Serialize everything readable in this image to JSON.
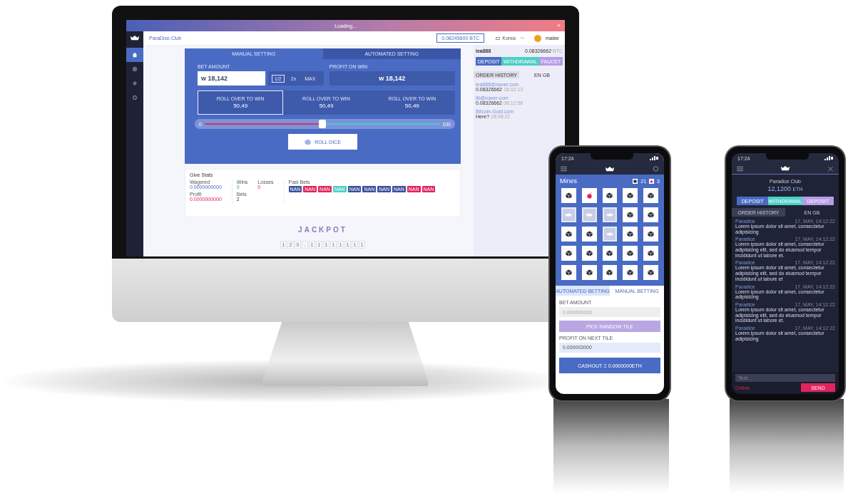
{
  "desktop": {
    "title_bar": {
      "title": "Loading...",
      "close": "×"
    },
    "sidebar": {
      "items": [
        {
          "kind": "home",
          "selected": true
        },
        {
          "kind": "dice",
          "selected": false
        },
        {
          "kind": "club",
          "selected": false
        },
        {
          "kind": "coin",
          "selected": false
        }
      ]
    },
    "header": {
      "brand": "ParaDice.Club",
      "balance": "0.08245600 BTC",
      "language": "Korea",
      "user": "malee"
    },
    "game": {
      "tabs": [
        {
          "label": "MANUAL SETTING",
          "selected": true
        },
        {
          "label": "AUTOMATED SETTING",
          "selected": false
        }
      ],
      "bet_label": "BET AMOUNT",
      "bet_value": "w 18,142",
      "multipliers": [
        {
          "label": "1/2",
          "selected": true
        },
        {
          "label": "2x",
          "selected": false
        },
        {
          "label": "MAX",
          "selected": false
        }
      ],
      "profit_label": "PROFIT ON WIN",
      "profit_value": "w 18,142",
      "rolls": [
        {
          "label": "ROLL OVER TO WIN",
          "value": "50,49",
          "selected": true
        },
        {
          "label": "ROLL OVER TO WIN",
          "value": "50,49",
          "selected": false
        },
        {
          "label": "ROLL OVER TO WIN",
          "value": "50,49",
          "selected": false
        }
      ],
      "slider": {
        "min": "0",
        "max": "100",
        "level": 0.5
      },
      "roll_button": "ROLL DICE"
    },
    "stats": {
      "title": "Give Stats",
      "wagered_label": "Wagered",
      "wagered": "0.0000000000",
      "profit_label": "Profit",
      "profit": "0.0000000000",
      "wins_label": "Wins",
      "wins": "0",
      "bets_label": "Bets",
      "bets": "2",
      "losses_label": "Losses",
      "losses": "0",
      "past_label": "Past Bets",
      "past_bets": [
        {
          "label": "NAN",
          "color": "#3b4f9c"
        },
        {
          "label": "NAN",
          "color": "#e0245e"
        },
        {
          "label": "NAN",
          "color": "#e0245e"
        },
        {
          "label": "NAN",
          "color": "#4ccfc4"
        },
        {
          "label": "NAN",
          "color": "#3b4f9c"
        },
        {
          "label": "NAN",
          "color": "#3b4f9c"
        },
        {
          "label": "NAN",
          "color": "#3b4f9c"
        },
        {
          "label": "NAN",
          "color": "#3b4f9c"
        },
        {
          "label": "NAN",
          "color": "#e0245e"
        },
        {
          "label": "NAN",
          "color": "#e0245e"
        }
      ]
    },
    "jackpot": {
      "title": "JACKPOT",
      "digits": [
        "1",
        "2",
        "0",
        ".",
        "1",
        "1",
        "1",
        "1",
        "1",
        "1",
        "1",
        "1"
      ]
    },
    "panel": {
      "user": "lea888",
      "amount": "0.08326662",
      "unit": "BTC",
      "buttons": [
        {
          "label": "DEPOSIT",
          "color": "#4a6bc4"
        },
        {
          "label": "WITHDRAWAL",
          "color": "#4ccfc4"
        },
        {
          "label": "FAUCET",
          "color": "#b79be6"
        }
      ],
      "tabs": [
        {
          "label": "ORDER HISTORY",
          "selected": true
        },
        {
          "label": "EN GB",
          "selected": false
        }
      ],
      "messages": [
        {
          "from": "lea888@naver.com",
          "text": "0.08326662",
          "time": "18:02:13"
        },
        {
          "from": "lili@naver.com",
          "text": "0.08326662",
          "time": "08:12:58"
        },
        {
          "from": "Bitcoin-Gold.com",
          "text": "Here?",
          "time": "18:08:22"
        }
      ]
    }
  },
  "mines_phone": {
    "time": "17:24",
    "title": "Mines",
    "gems": "21",
    "bombs": "3",
    "tiles": [
      [
        {
          "kind": "gem"
        },
        {
          "kind": "bomb"
        },
        {
          "kind": "gem"
        },
        {
          "kind": "gem"
        },
        {
          "kind": "gem"
        }
      ],
      [
        {
          "kind": "revealed"
        },
        {
          "kind": "revealed"
        },
        {
          "kind": "revealed"
        },
        {
          "kind": "gem"
        },
        {
          "kind": "gem"
        }
      ],
      [
        {
          "kind": "gem"
        },
        {
          "kind": "gem"
        },
        {
          "kind": "revealed"
        },
        {
          "kind": "gem"
        },
        {
          "kind": "gem"
        }
      ],
      [
        {
          "kind": "gem"
        },
        {
          "kind": "gem"
        },
        {
          "kind": "gem"
        },
        {
          "kind": "gem"
        },
        {
          "kind": "gem"
        }
      ],
      [
        {
          "kind": "gem"
        },
        {
          "kind": "gem"
        },
        {
          "kind": "gem"
        },
        {
          "kind": "gem"
        },
        {
          "kind": "gem"
        }
      ]
    ],
    "tabs": [
      {
        "label": "AUTOMATED BETTING",
        "selected": true
      },
      {
        "label": "MANUAL BETTING",
        "selected": false
      }
    ],
    "bet_label": "BET AMOUNT",
    "bet_placeholder": "0.000000000",
    "pick_button": "PICK RANDOM TILE",
    "profit_label": "PROFIT ON NEXT TILE",
    "profit_value": "0.000003000",
    "cashout_button": "CASHOUT Ξ 0.0000000ETH"
  },
  "chat_phone": {
    "time": "17:24",
    "name": "Paradice Club",
    "balance": "12,1200",
    "unit": "ETH",
    "buttons": [
      {
        "label": "DEPOSIT",
        "color": "#4a6bc4"
      },
      {
        "label": "WITHDRAWAL",
        "color": "#4ccfc4"
      },
      {
        "label": "DEPOSIT",
        "color": "#b79be6"
      }
    ],
    "tabs": [
      {
        "label": "ORDER HISTORY",
        "selected": true
      },
      {
        "label": "EN GB",
        "selected": false
      }
    ],
    "messages": [
      {
        "from": "Paradice",
        "time": "17, MAY, 14:12:22",
        "text": "Lorem ipsum dolor sit amet, consectetur adipisicing"
      },
      {
        "from": "Paradice",
        "time": "17, MAY, 14:12:22",
        "text": "Lorem ipsum dolor sit amet, consectetur adipisicing elit, sed do eiusmod tempor incididunt ut labore et."
      },
      {
        "from": "Paradice",
        "time": "17, MAY, 14:12:22",
        "text": "Lorem ipsum dolor sit amet, consectetur adipisicing elit, sed do eiusmod tempor incididunt ut labore et"
      },
      {
        "from": "Paradice",
        "time": "17, MAY, 14:12:22",
        "text": "Lorem ipsum dolor sit amet, consectetur adipisicing"
      },
      {
        "from": "Paradice",
        "time": "17, MAY, 14:12:22",
        "text": "Lorem ipsum dolor sit amet, consectetur adipisicing elit, sed do eiusmod tempor incididunt ut labore et."
      },
      {
        "from": "Paradice",
        "time": "17, MAY, 14:12:22",
        "text": "Lorem ipsum dolor sit amet, consectetur adipisicing"
      }
    ],
    "input_placeholder": "Text...",
    "status": "Online",
    "send_button": "SEND"
  }
}
